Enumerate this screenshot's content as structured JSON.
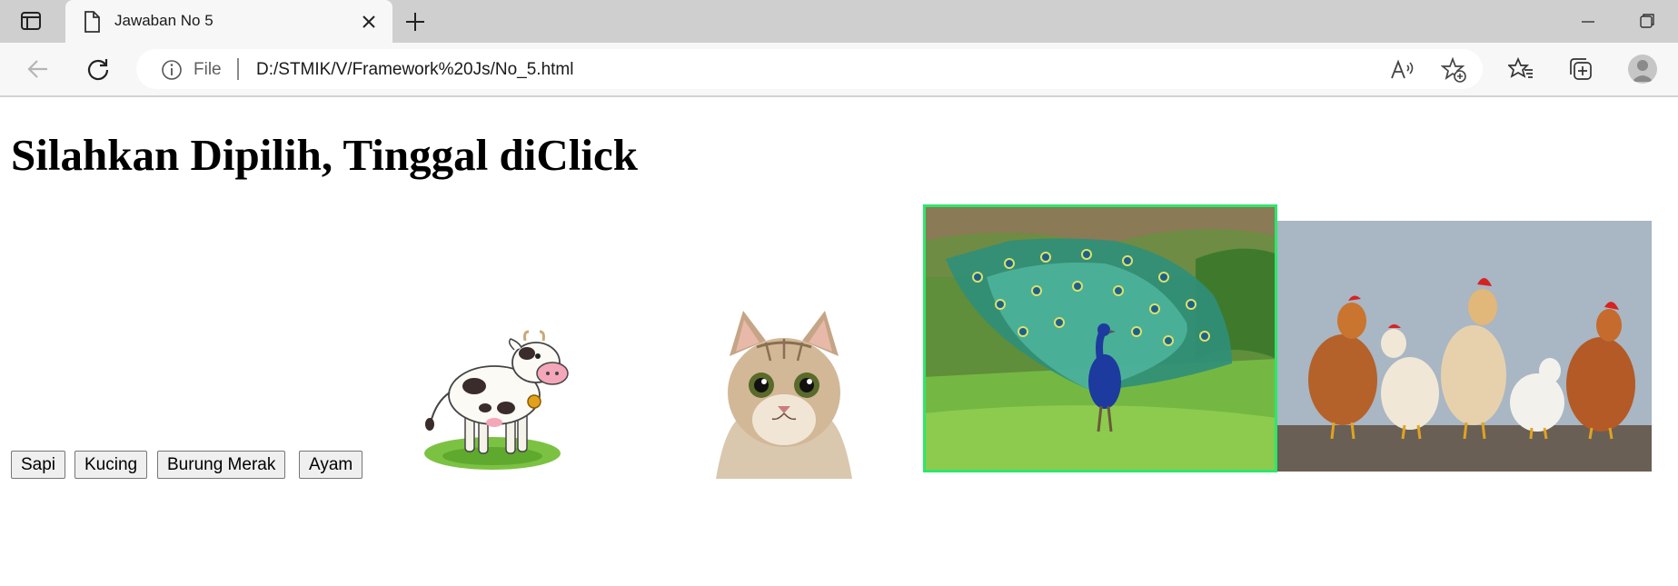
{
  "browser": {
    "tab": {
      "title": "Jawaban No 5"
    },
    "address_bar": {
      "site_label": "File",
      "url": "D:/STMIK/V/Framework%20Js/No_5.html"
    },
    "icons": [
      "tab-actions-icon",
      "page-icon",
      "close-icon",
      "plus-icon",
      "minimize-icon",
      "restore-icon",
      "back-icon",
      "refresh-icon",
      "info-icon",
      "read-aloud-icon",
      "add-favorite-icon",
      "favorites-icon",
      "collections-icon",
      "profile-icon"
    ]
  },
  "page": {
    "heading": "Silahkan Dipilih, Tinggal diClick",
    "buttons": [
      {
        "label": "Sapi"
      },
      {
        "label": "Kucing"
      },
      {
        "label": "Burung Merak"
      },
      {
        "label": "Ayam"
      }
    ],
    "images": [
      {
        "subject": "cow"
      },
      {
        "subject": "cat"
      },
      {
        "subject": "peacock",
        "selected": true
      },
      {
        "subject": "chickens"
      }
    ],
    "colors": {
      "selection_border": "#2ee66b"
    }
  }
}
